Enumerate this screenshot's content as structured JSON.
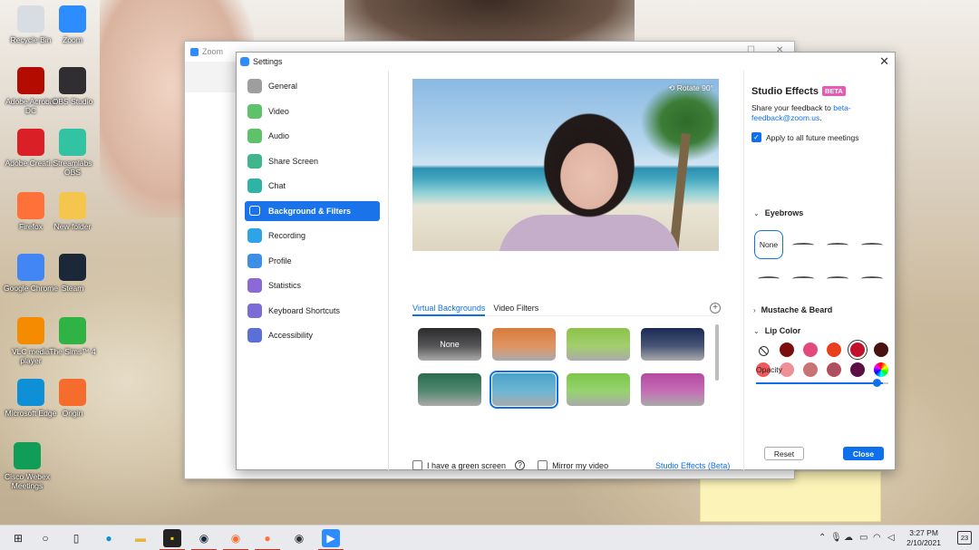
{
  "desktop": {
    "icons": [
      {
        "label": "Recycle Bin",
        "icon": "recycle-bin-icon",
        "color": "#d8dde3"
      },
      {
        "label": "Zoom",
        "icon": "zoom-icon",
        "color": "#2d8cff"
      },
      {
        "label": "Adobe Acrobat DC",
        "icon": "acrobat-icon",
        "color": "#b30b00"
      },
      {
        "label": "OBS Studio",
        "icon": "obs-icon",
        "color": "#302e31"
      },
      {
        "label": "Adobe Creati...",
        "icon": "creative-cloud-icon",
        "color": "#da1f26"
      },
      {
        "label": "Streamlabs OBS",
        "icon": "streamlabs-icon",
        "color": "#31c3a2"
      },
      {
        "label": "Firefox",
        "icon": "firefox-icon",
        "color": "#ff7139"
      },
      {
        "label": "New folder",
        "icon": "folder-icon",
        "color": "#f4c64e"
      },
      {
        "label": "Google Chrome",
        "icon": "chrome-icon",
        "color": "#4285f4"
      },
      {
        "label": "Steam",
        "icon": "steam-icon",
        "color": "#1b2838"
      },
      {
        "label": "VLC media player",
        "icon": "vlc-icon",
        "color": "#f48b00"
      },
      {
        "label": "The Sims™ 4",
        "icon": "sims-icon",
        "color": "#2fb344"
      },
      {
        "label": "Microsoft Edge",
        "icon": "edge-icon",
        "color": "#0f8fd6"
      },
      {
        "label": "Origin",
        "icon": "origin-icon",
        "color": "#f56c2d"
      },
      {
        "label": "Cisco Webex Meetings",
        "icon": "webex-icon",
        "color": "#0f9d58"
      }
    ]
  },
  "zoom_window": {
    "title": "Zoom"
  },
  "settings": {
    "title": "Settings",
    "nav": [
      {
        "label": "General",
        "icon": "gear-icon",
        "color": "#9e9e9e"
      },
      {
        "label": "Video",
        "icon": "video-icon",
        "color": "#5ec26a"
      },
      {
        "label": "Audio",
        "icon": "headphones-icon",
        "color": "#5ec26a"
      },
      {
        "label": "Share Screen",
        "icon": "share-screen-icon",
        "color": "#3fb68b"
      },
      {
        "label": "Chat",
        "icon": "chat-icon",
        "color": "#2fb3a5"
      },
      {
        "label": "Background & Filters",
        "icon": "background-icon",
        "color": "#ffffff"
      },
      {
        "label": "Recording",
        "icon": "recording-icon",
        "color": "#2ea3e8"
      },
      {
        "label": "Profile",
        "icon": "profile-icon",
        "color": "#3d8ee8"
      },
      {
        "label": "Statistics",
        "icon": "statistics-icon",
        "color": "#8b6ad8"
      },
      {
        "label": "Keyboard Shortcuts",
        "icon": "keyboard-icon",
        "color": "#7c6cd6"
      },
      {
        "label": "Accessibility",
        "icon": "accessibility-icon",
        "color": "#5b6fd8"
      }
    ],
    "active_nav": "Background & Filters",
    "preview": {
      "rotate_label": "Rotate 90°"
    },
    "tabs": [
      {
        "label": "Virtual Backgrounds",
        "active": true
      },
      {
        "label": "Video Filters",
        "active": false
      }
    ],
    "backgrounds": [
      {
        "label": "None",
        "color": "#2b2b2e",
        "selected": false
      },
      {
        "label": "",
        "color": "#d87a3c",
        "selected": false
      },
      {
        "label": "",
        "color": "#8cc24a",
        "selected": false
      },
      {
        "label": "",
        "color": "#1b2a55",
        "selected": false
      },
      {
        "label": "",
        "color": "#2a6b4e",
        "selected": false
      },
      {
        "label": "",
        "color": "#4aa3c9",
        "selected": true
      },
      {
        "label": "",
        "color": "#7cc74a",
        "selected": false
      },
      {
        "label": "",
        "color": "#b64aa2",
        "selected": false
      }
    ],
    "green_screen_label": "I have a green screen",
    "mirror_label": "Mirror my video",
    "studio_effects_link": "Studio Effects (Beta)"
  },
  "studio": {
    "title": "Studio Effects",
    "badge": "BETA",
    "feedback_text": "Share your feedback to",
    "feedback_email": "beta-feedback@zoom.us",
    "feedback_end": ".",
    "apply_label": "Apply to all future meetings",
    "eyebrows_label": "Eyebrows",
    "eyebrow_none": "None",
    "mustache_label": "Mustache & Beard",
    "lip_label": "Lip Color",
    "lip_colors": [
      "#7a0d0d",
      "#e24a7c",
      "#e8401e",
      "#c2122a",
      "#4a1111",
      "#ee5a5a",
      "#ef8f98",
      "#c97474",
      "#b0505e",
      "#5b0f45"
    ],
    "lip_selected_index": 3,
    "opacity_label": "Opacity",
    "opacity_value": 0.95,
    "reset_label": "Reset",
    "close_label": "Close"
  },
  "taskbar": {
    "time": "3:27 PM",
    "date": "2/10/2021",
    "notifications": "23"
  }
}
